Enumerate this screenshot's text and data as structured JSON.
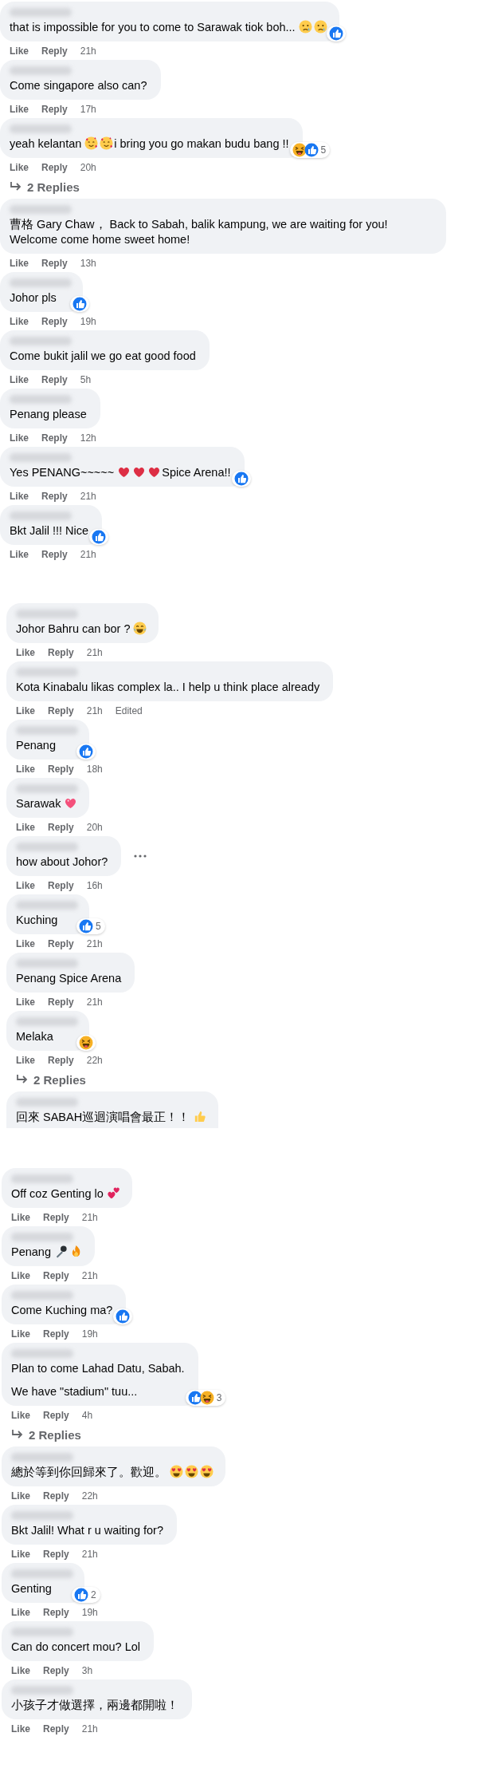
{
  "groups": [
    {
      "comments": [
        {
          "parts": [
            {
              "kind": "text",
              "text": "that is impossible for you to come to Sarawak tiok boh..."
            },
            {
              "kind": "tear-face"
            },
            {
              "kind": "tear-face"
            }
          ],
          "reactions": {
            "items": [
              {
                "kind": "like"
              }
            ]
          },
          "actions": [
            "Like",
            "Reply"
          ],
          "time": "21h"
        },
        {
          "parts": [
            {
              "kind": "text",
              "text": "Come singapore also can?"
            }
          ],
          "actions": [
            "Like",
            "Reply"
          ],
          "time": "17h"
        },
        {
          "parts": [
            {
              "kind": "text",
              "text": "yeah kelantan"
            },
            {
              "kind": "love-face"
            },
            {
              "kind": "love-face"
            },
            {
              "kind": "text",
              "text": "i bring you go makan budu bang !!"
            }
          ],
          "reactions": {
            "items": [
              {
                "kind": "haha"
              },
              {
                "kind": "like"
              }
            ],
            "count": "5"
          },
          "actions": [
            "Like",
            "Reply"
          ],
          "time": "20h",
          "replies": "2 Replies"
        },
        {
          "parts": [
            {
              "kind": "text",
              "text": "曹格 Gary Chaw， Back to Sabah, balik kampung, we are waiting for you! Welcome come home sweet home!"
            }
          ],
          "actions": [
            "Like",
            "Reply"
          ],
          "time": "13h"
        },
        {
          "parts": [
            {
              "kind": "text",
              "text": "Johor pls"
            }
          ],
          "reactions": {
            "items": [
              {
                "kind": "like"
              }
            ]
          },
          "actions": [
            "Like",
            "Reply"
          ],
          "time": "19h"
        },
        {
          "parts": [
            {
              "kind": "text",
              "text": "Come bukit jalil we go eat good food"
            }
          ],
          "actions": [
            "Like",
            "Reply"
          ],
          "time": "5h"
        },
        {
          "parts": [
            {
              "kind": "text",
              "text": "Penang please"
            }
          ],
          "actions": [
            "Like",
            "Reply"
          ],
          "time": "12h"
        },
        {
          "parts": [
            {
              "kind": "text",
              "text": "Yes PENANG~~~~~"
            },
            {
              "kind": "heart"
            },
            {
              "kind": "heart"
            },
            {
              "kind": "heart"
            },
            {
              "kind": "text",
              "text": "Spice Arena!!"
            }
          ],
          "reactions": {
            "items": [
              {
                "kind": "like"
              }
            ]
          },
          "actions": [
            "Like",
            "Reply"
          ],
          "time": "21h"
        },
        {
          "parts": [
            {
              "kind": "text",
              "text": "Bkt Jalil !!! Nice"
            }
          ],
          "reactions": {
            "items": [
              {
                "kind": "like"
              }
            ]
          },
          "actions": [
            "Like",
            "Reply"
          ],
          "time": "21h"
        }
      ]
    },
    {
      "comments": [
        {
          "parts": [
            {
              "kind": "text",
              "text": "Johor Bahru can bor ?"
            },
            {
              "kind": "joy-face"
            }
          ],
          "actions": [
            "Like",
            "Reply"
          ],
          "time": "21h"
        },
        {
          "parts": [
            {
              "kind": "text",
              "text": "Kota Kinabalu likas complex la.. I help u think place already"
            }
          ],
          "actions": [
            "Like",
            "Reply"
          ],
          "time": "21h",
          "edited": "Edited"
        },
        {
          "parts": [
            {
              "kind": "text",
              "text": "Penang"
            }
          ],
          "reactions": {
            "items": [
              {
                "kind": "like"
              }
            ]
          },
          "actions": [
            "Like",
            "Reply"
          ],
          "time": "18h"
        },
        {
          "parts": [
            {
              "kind": "text",
              "text": "Sarawak"
            },
            {
              "kind": "sparkling-heart"
            }
          ],
          "actions": [
            "Like",
            "Reply"
          ],
          "time": "20h"
        },
        {
          "parts": [
            {
              "kind": "text",
              "text": "how about Johor?"
            }
          ],
          "more_options": true,
          "actions": [
            "Like",
            "Reply"
          ],
          "time": "16h"
        },
        {
          "parts": [
            {
              "kind": "text",
              "text": "Kuching"
            }
          ],
          "reactions": {
            "items": [
              {
                "kind": "like"
              }
            ],
            "count": "5"
          },
          "actions": [
            "Like",
            "Reply"
          ],
          "time": "21h"
        },
        {
          "parts": [
            {
              "kind": "text",
              "text": "Penang Spice Arena"
            }
          ],
          "actions": [
            "Like",
            "Reply"
          ],
          "time": "21h"
        },
        {
          "parts": [
            {
              "kind": "text",
              "text": "Melaka"
            }
          ],
          "reactions": {
            "items": [
              {
                "kind": "haha"
              }
            ]
          },
          "actions": [
            "Like",
            "Reply"
          ],
          "time": "22h",
          "replies": "2 Replies"
        },
        {
          "parts": [
            {
              "kind": "text",
              "text": "回來 SABAH巡迴演唱會最正！！"
            },
            {
              "kind": "thumbs-up"
            }
          ],
          "cut": true
        }
      ]
    },
    {
      "comments": [
        {
          "parts": [
            {
              "kind": "text",
              "text": "Off coz Genting lo"
            },
            {
              "kind": "two-hearts"
            }
          ],
          "actions": [
            "Like",
            "Reply"
          ],
          "time": "21h"
        },
        {
          "parts": [
            {
              "kind": "text",
              "text": "Penang"
            },
            {
              "kind": "mic"
            },
            {
              "kind": "fire"
            }
          ],
          "actions": [
            "Like",
            "Reply"
          ],
          "time": "21h"
        },
        {
          "parts": [
            {
              "kind": "text",
              "text": "Come Kuching ma?"
            }
          ],
          "reactions": {
            "items": [
              {
                "kind": "like"
              }
            ]
          },
          "actions": [
            "Like",
            "Reply"
          ],
          "time": "19h"
        },
        {
          "parts": [
            {
              "kind": "text",
              "text": "Plan to come Lahad Datu, Sabah."
            },
            {
              "kind": "break"
            },
            {
              "kind": "text",
              "text": "We have \"stadium\" tuu..."
            }
          ],
          "reactions": {
            "items": [
              {
                "kind": "like"
              },
              {
                "kind": "haha"
              }
            ],
            "count": "3"
          },
          "actions": [
            "Like",
            "Reply"
          ],
          "time": "4h",
          "replies": "2 Replies"
        },
        {
          "parts": [
            {
              "kind": "text",
              "text": "總於等到你回歸來了。歡迎。"
            },
            {
              "kind": "heart-eyes"
            },
            {
              "kind": "heart-eyes"
            },
            {
              "kind": "heart-eyes"
            }
          ],
          "actions": [
            "Like",
            "Reply"
          ],
          "time": "22h"
        },
        {
          "parts": [
            {
              "kind": "text",
              "text": "Bkt Jalil! What r u waiting for?"
            }
          ],
          "actions": [
            "Like",
            "Reply"
          ],
          "time": "21h"
        },
        {
          "parts": [
            {
              "kind": "text",
              "text": "Genting"
            }
          ],
          "reactions": {
            "items": [
              {
                "kind": "like"
              }
            ],
            "count": "2"
          },
          "actions": [
            "Like",
            "Reply"
          ],
          "time": "19h"
        },
        {
          "parts": [
            {
              "kind": "text",
              "text": "Can do concert mou? Lol"
            }
          ],
          "actions": [
            "Like",
            "Reply"
          ],
          "time": "3h"
        },
        {
          "parts": [
            {
              "kind": "text",
              "text": "小孩子才做選擇，兩邊都開啦！"
            }
          ],
          "actions": [
            "Like",
            "Reply"
          ],
          "time": "21h"
        }
      ]
    }
  ]
}
